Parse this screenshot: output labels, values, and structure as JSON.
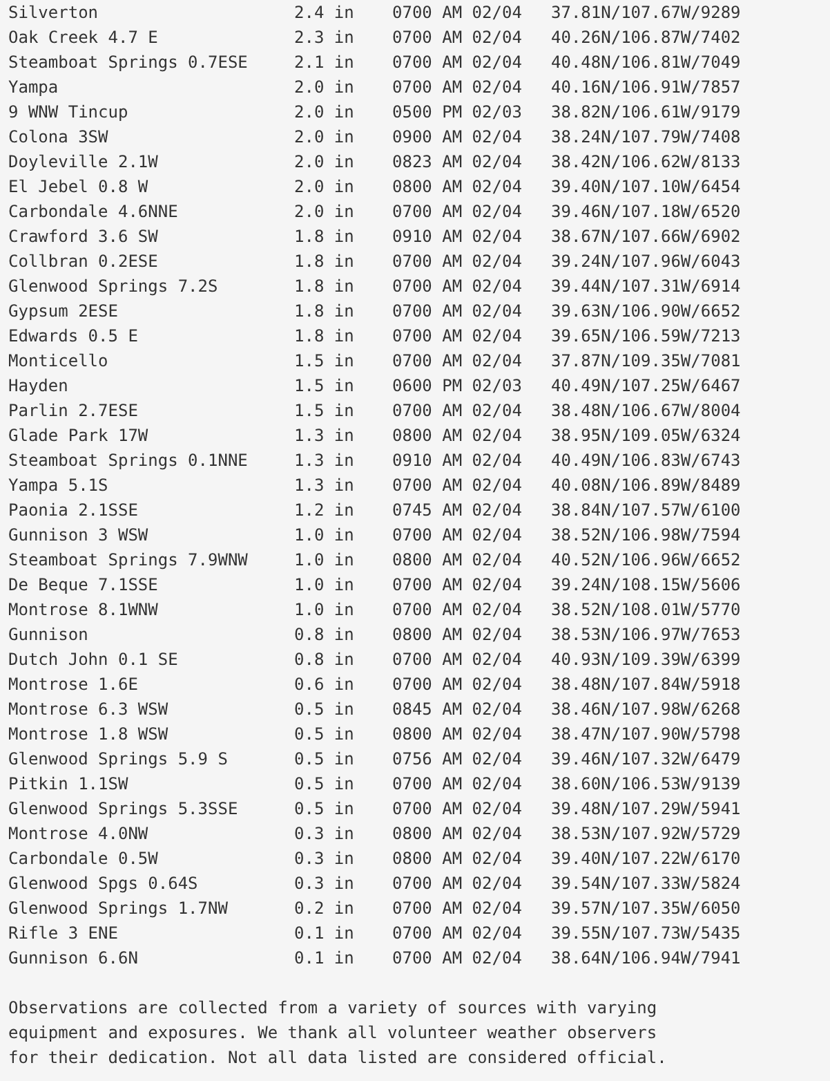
{
  "rows": [
    {
      "station": "Silverton",
      "amount": "2.4 in",
      "time": "0700 AM 02/04",
      "location": "37.81N/107.67W/9289"
    },
    {
      "station": "Oak Creek 4.7 E",
      "amount": "2.3 in",
      "time": "0700 AM 02/04",
      "location": "40.26N/106.87W/7402"
    },
    {
      "station": "Steamboat Springs 0.7ESE",
      "amount": "2.1 in",
      "time": "0700 AM 02/04",
      "location": "40.48N/106.81W/7049"
    },
    {
      "station": "Yampa",
      "amount": "2.0 in",
      "time": "0700 AM 02/04",
      "location": "40.16N/106.91W/7857"
    },
    {
      "station": "9 WNW Tincup",
      "amount": "2.0 in",
      "time": "0500 PM 02/03",
      "location": "38.82N/106.61W/9179"
    },
    {
      "station": "Colona 3SW",
      "amount": "2.0 in",
      "time": "0900 AM 02/04",
      "location": "38.24N/107.79W/7408"
    },
    {
      "station": "Doyleville 2.1W",
      "amount": "2.0 in",
      "time": "0823 AM 02/04",
      "location": "38.42N/106.62W/8133"
    },
    {
      "station": "El Jebel 0.8 W",
      "amount": "2.0 in",
      "time": "0800 AM 02/04",
      "location": "39.40N/107.10W/6454"
    },
    {
      "station": "Carbondale 4.6NNE",
      "amount": "2.0 in",
      "time": "0700 AM 02/04",
      "location": "39.46N/107.18W/6520"
    },
    {
      "station": "Crawford 3.6 SW",
      "amount": "1.8 in",
      "time": "0910 AM 02/04",
      "location": "38.67N/107.66W/6902"
    },
    {
      "station": "Collbran 0.2ESE",
      "amount": "1.8 in",
      "time": "0700 AM 02/04",
      "location": "39.24N/107.96W/6043"
    },
    {
      "station": "Glenwood Springs 7.2S",
      "amount": "1.8 in",
      "time": "0700 AM 02/04",
      "location": "39.44N/107.31W/6914"
    },
    {
      "station": "Gypsum 2ESE",
      "amount": "1.8 in",
      "time": "0700 AM 02/04",
      "location": "39.63N/106.90W/6652"
    },
    {
      "station": "Edwards 0.5 E",
      "amount": "1.8 in",
      "time": "0700 AM 02/04",
      "location": "39.65N/106.59W/7213"
    },
    {
      "station": "Monticello",
      "amount": "1.5 in",
      "time": "0700 AM 02/04",
      "location": "37.87N/109.35W/7081"
    },
    {
      "station": "Hayden",
      "amount": "1.5 in",
      "time": "0600 PM 02/03",
      "location": "40.49N/107.25W/6467"
    },
    {
      "station": "Parlin 2.7ESE",
      "amount": "1.5 in",
      "time": "0700 AM 02/04",
      "location": "38.48N/106.67W/8004"
    },
    {
      "station": "Glade Park 17W",
      "amount": "1.3 in",
      "time": "0800 AM 02/04",
      "location": "38.95N/109.05W/6324"
    },
    {
      "station": "Steamboat Springs 0.1NNE",
      "amount": "1.3 in",
      "time": "0910 AM 02/04",
      "location": "40.49N/106.83W/6743"
    },
    {
      "station": "Yampa 5.1S",
      "amount": "1.3 in",
      "time": "0700 AM 02/04",
      "location": "40.08N/106.89W/8489"
    },
    {
      "station": "Paonia 2.1SSE",
      "amount": "1.2 in",
      "time": "0745 AM 02/04",
      "location": "38.84N/107.57W/6100"
    },
    {
      "station": "Gunnison 3 WSW",
      "amount": "1.0 in",
      "time": "0700 AM 02/04",
      "location": "38.52N/106.98W/7594"
    },
    {
      "station": "Steamboat Springs 7.9WNW",
      "amount": "1.0 in",
      "time": "0800 AM 02/04",
      "location": "40.52N/106.96W/6652"
    },
    {
      "station": "De Beque 7.1SSE",
      "amount": "1.0 in",
      "time": "0700 AM 02/04",
      "location": "39.24N/108.15W/5606"
    },
    {
      "station": "Montrose 8.1WNW",
      "amount": "1.0 in",
      "time": "0700 AM 02/04",
      "location": "38.52N/108.01W/5770"
    },
    {
      "station": "Gunnison",
      "amount": "0.8 in",
      "time": "0800 AM 02/04",
      "location": "38.53N/106.97W/7653"
    },
    {
      "station": "Dutch John 0.1 SE",
      "amount": "0.8 in",
      "time": "0700 AM 02/04",
      "location": "40.93N/109.39W/6399"
    },
    {
      "station": "Montrose 1.6E",
      "amount": "0.6 in",
      "time": "0700 AM 02/04",
      "location": "38.48N/107.84W/5918"
    },
    {
      "station": "Montrose 6.3 WSW",
      "amount": "0.5 in",
      "time": "0845 AM 02/04",
      "location": "38.46N/107.98W/6268"
    },
    {
      "station": "Montrose 1.8 WSW",
      "amount": "0.5 in",
      "time": "0800 AM 02/04",
      "location": "38.47N/107.90W/5798"
    },
    {
      "station": "Glenwood Springs 5.9 S",
      "amount": "0.5 in",
      "time": "0756 AM 02/04",
      "location": "39.46N/107.32W/6479"
    },
    {
      "station": "Pitkin 1.1SW",
      "amount": "0.5 in",
      "time": "0700 AM 02/04",
      "location": "38.60N/106.53W/9139"
    },
    {
      "station": "Glenwood Springs 5.3SSE",
      "amount": "0.5 in",
      "time": "0700 AM 02/04",
      "location": "39.48N/107.29W/5941"
    },
    {
      "station": "Montrose 4.0NW",
      "amount": "0.3 in",
      "time": "0800 AM 02/04",
      "location": "38.53N/107.92W/5729"
    },
    {
      "station": "Carbondale 0.5W",
      "amount": "0.3 in",
      "time": "0800 AM 02/04",
      "location": "39.40N/107.22W/6170"
    },
    {
      "station": "Glenwood Spgs 0.64S",
      "amount": "0.3 in",
      "time": "0700 AM 02/04",
      "location": "39.54N/107.33W/5824"
    },
    {
      "station": "Glenwood Springs 1.7NW",
      "amount": "0.2 in",
      "time": "0700 AM 02/04",
      "location": "39.57N/107.35W/6050"
    },
    {
      "station": "Rifle 3 ENE",
      "amount": "0.1 in",
      "time": "0700 AM 02/04",
      "location": "39.55N/107.73W/5435"
    },
    {
      "station": "Gunnison 6.6N",
      "amount": "0.1 in",
      "time": "0700 AM 02/04",
      "location": "38.64N/106.94W/7941"
    }
  ],
  "note": "Observations are collected from a variety of sources with varying equipment and exposures. We thank all volunteer weather observers for their dedication. Not all data listed are considered official."
}
